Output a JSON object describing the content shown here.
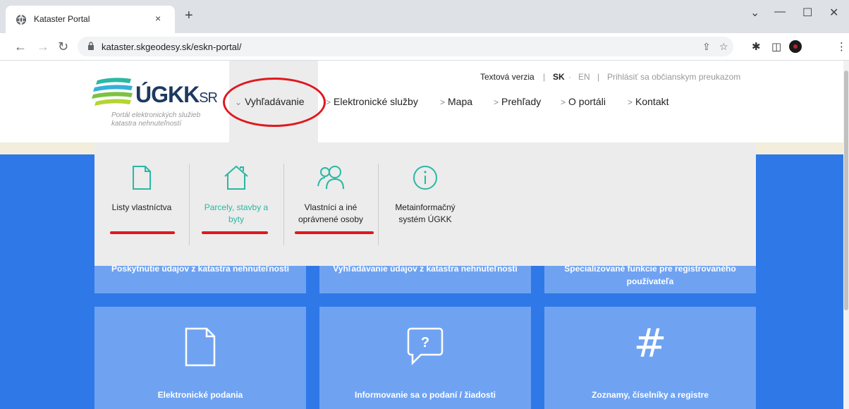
{
  "browser": {
    "tab_title": "Kataster Portal",
    "tab_close": "×",
    "new_tab": "+",
    "url": "kataster.skgeodesy.sk/eskn-portal/",
    "window_controls": {
      "dropdown": "⌄",
      "minimize": "—",
      "maximize": "☐",
      "close": "✕"
    },
    "icons": [
      "back-icon",
      "forward-icon",
      "reload-icon",
      "lock-icon",
      "share-icon",
      "star-icon",
      "extensions-icon",
      "sidepanel-icon",
      "profile-icon",
      "menu-icon"
    ]
  },
  "logo": {
    "main": "ÚGKK",
    "suffix": "SR",
    "subtitle": "Portál elektronických služieb katastra nehnuteľností"
  },
  "topbar": {
    "text_version": "Textová verzia",
    "sep1": "|",
    "lang_sk": "SK",
    "dot": "·",
    "lang_en": "EN",
    "sep2": "|",
    "login": "Prihlásiť sa občianskym preukazom"
  },
  "menu": [
    {
      "label": "Vyhľadávanie",
      "chev": "⌄"
    },
    {
      "label": "Elektronické služby",
      "chev": ">"
    },
    {
      "label": "Mapa",
      "chev": ">"
    },
    {
      "label": "Prehľady",
      "chev": ">"
    },
    {
      "label": "O portáli",
      "chev": ">"
    },
    {
      "label": "Kontakt",
      "chev": ">"
    }
  ],
  "dropdown": [
    {
      "line1": "Listy vlastníctva",
      "line2": "",
      "icon": "document-icon"
    },
    {
      "line1": "Parcely, stavby a",
      "line2": "byty",
      "icon": "house-icon"
    },
    {
      "line1": "Vlastníci a iné",
      "line2": "oprávnené osoby",
      "icon": "people-icon"
    },
    {
      "line1": "Metainformačný",
      "line2": "systém ÚGKK",
      "icon": "info-icon"
    }
  ],
  "cards_row1": [
    {
      "line1": "Poskytnutie údajov z katastra nehnuteľností",
      "line2": ""
    },
    {
      "line1": "Vyhľadávanie údajov z katastra nehnuteľností",
      "line2": ""
    },
    {
      "line1": "Špecializované funkcie pre registrovaného",
      "line2": "používateľa"
    }
  ],
  "cards_row2": [
    {
      "label": "Elektronické podania",
      "icon": "document-icon"
    },
    {
      "label": "Informovanie sa o podaní / žiadosti",
      "icon": "question-bubble-icon",
      "glyph": "?"
    },
    {
      "label": "Zoznamy, číselníky a registre",
      "icon": "hash-icon",
      "glyph": "#"
    }
  ],
  "colors": {
    "accent_red": "#e0181f",
    "accent_teal": "#2ab8a4",
    "page_blue": "#2f78e8",
    "card_blue": "#6fa3f2"
  }
}
